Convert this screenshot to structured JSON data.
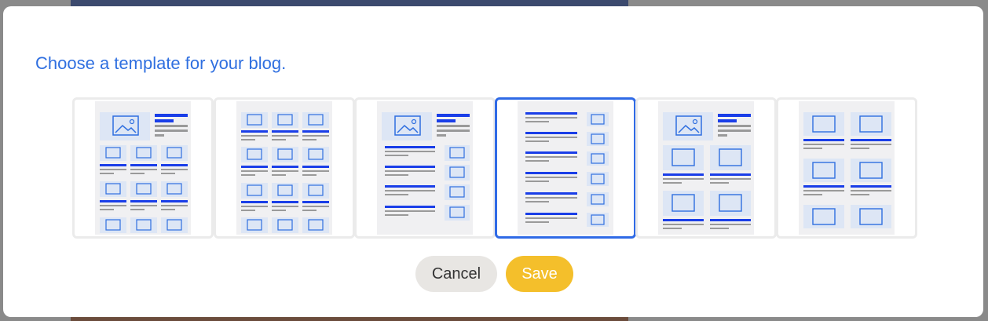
{
  "dialog": {
    "title": "Choose a template for your blog.",
    "templates": [
      {
        "id": "template-1",
        "selected": false
      },
      {
        "id": "template-2",
        "selected": false
      },
      {
        "id": "template-3",
        "selected": false
      },
      {
        "id": "template-4",
        "selected": true
      },
      {
        "id": "template-5",
        "selected": false
      },
      {
        "id": "template-6",
        "selected": false
      }
    ],
    "cancel_label": "Cancel",
    "save_label": "Save"
  },
  "colors": {
    "accent": "#2f6fe0",
    "selected_border": "#2f6ae6",
    "save_button": "#f4bf2b",
    "cancel_button": "#e8e6e3",
    "placeholder_fill": "#dde6f5",
    "headline_bar": "#1a3ee8",
    "text_bar": "#9a9a9a"
  },
  "icons": {
    "thumbnail": "image-placeholder-icon"
  }
}
